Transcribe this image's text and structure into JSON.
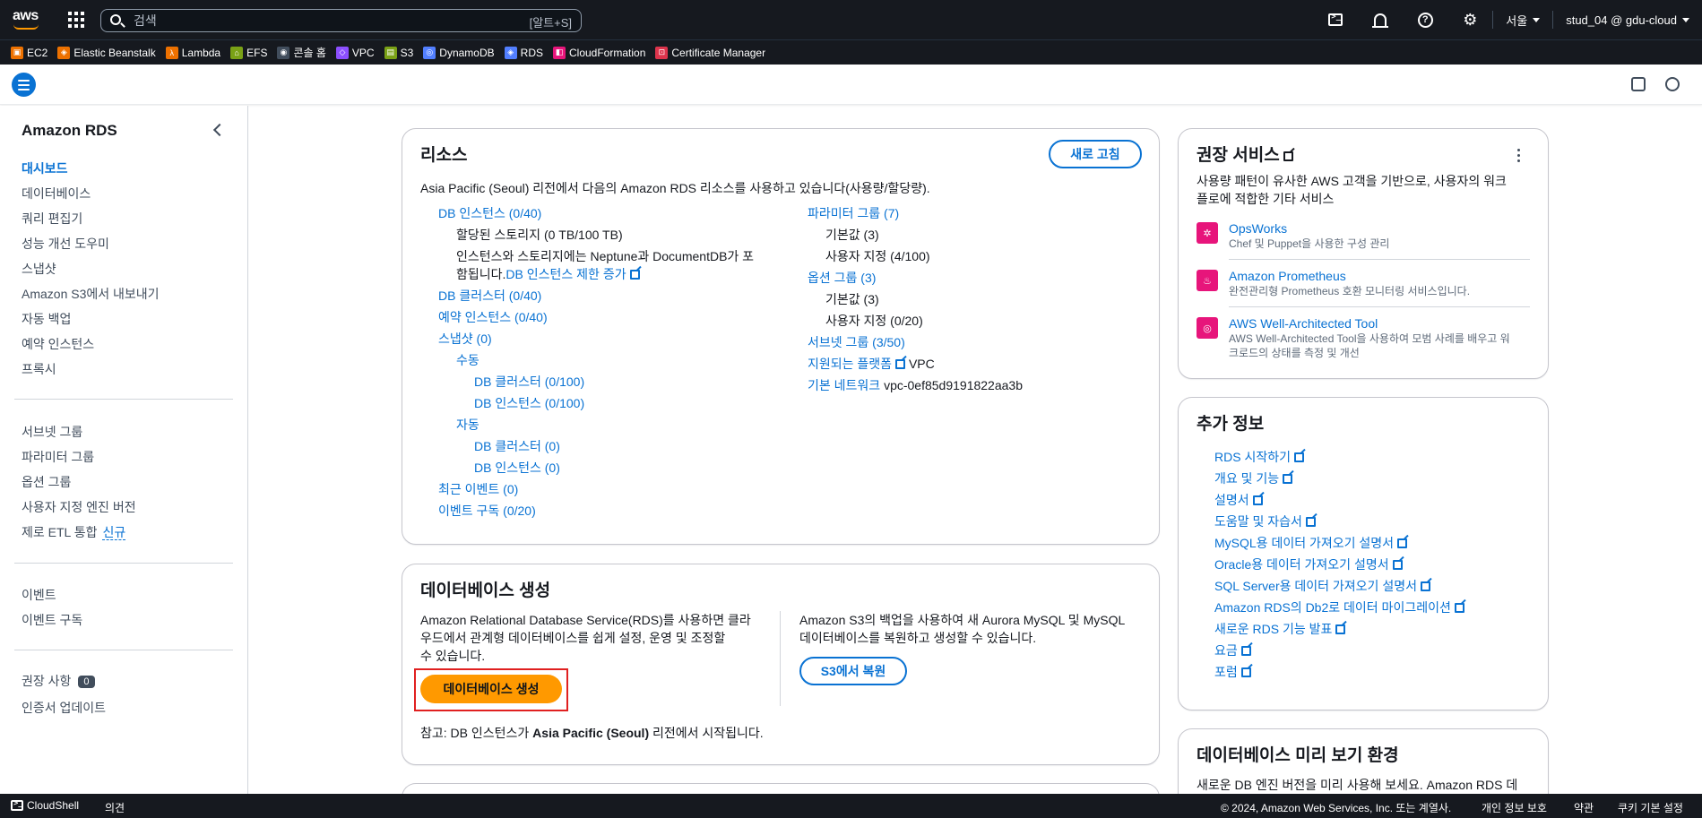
{
  "topnav": {
    "logo_text": "aws",
    "search_placeholder": "검색",
    "search_shortcut": "[알트+S]",
    "region": "서울",
    "account": "stud_04 @ gdu-cloud"
  },
  "favorites": [
    {
      "label": "EC2",
      "color": "#ed7100"
    },
    {
      "label": "Elastic Beanstalk",
      "color": "#ed7100"
    },
    {
      "label": "Lambda",
      "color": "#ed7100"
    },
    {
      "label": "EFS",
      "color": "#7aa116"
    },
    {
      "label": "콘솔 홈",
      "color": "#414d5c"
    },
    {
      "label": "VPC",
      "color": "#8c4fff"
    },
    {
      "label": "S3",
      "color": "#7aa116"
    },
    {
      "label": "DynamoDB",
      "color": "#527fff"
    },
    {
      "label": "RDS",
      "color": "#527fff"
    },
    {
      "label": "CloudFormation",
      "color": "#e7157b"
    },
    {
      "label": "Certificate Manager",
      "color": "#dd344c"
    }
  ],
  "sidebar": {
    "title": "Amazon RDS",
    "group1": [
      "대시보드",
      "데이터베이스",
      "쿼리 편집기",
      "성능 개선 도우미",
      "스냅샷",
      "Amazon S3에서 내보내기",
      "자동 백업",
      "예약 인스턴스",
      "프록시"
    ],
    "group2": [
      "서브넷 그룹",
      "파라미터 그룹",
      "옵션 그룹",
      "사용자 지정 엔진 버전",
      "제로 ETL 통합"
    ],
    "new_label": "신규",
    "group3": [
      "이벤트",
      "이벤트 구독"
    ],
    "recommendations": "권장 사항",
    "recommendations_count": "0",
    "cert_update": "인증서 업데이트"
  },
  "resources": {
    "title": "리소스",
    "refresh": "새로 고침",
    "intro": "Asia Pacific (Seoul) 리전에서 다음의 Amazon RDS 리소스를 사용하고 있습니다(사용량/할당량).",
    "db_instances": "DB 인스턴스 (0/40)",
    "storage": "할당된 스토리지 (0 TB/100 TB)",
    "note_line1": "인스턴스와 스토리지에는 Neptune과 DocumentDB가 포",
    "note_line2": "함됩니다.",
    "limit_link": "DB 인스턴스 제한 증가",
    "db_clusters": "DB 클러스터 (0/40)",
    "reserved": "예약 인스턴스 (0/40)",
    "snapshots": "스냅샷 (0)",
    "manual": "수동",
    "manual_clusters": "DB 클러스터 (0/100)",
    "manual_instances": "DB 인스턴스 (0/100)",
    "auto": "자동",
    "auto_clusters": "DB 클러스터 (0)",
    "auto_instances": "DB 인스턴스 (0)",
    "recent_events": "최근 이벤트 (0)",
    "event_subs": "이벤트 구독 (0/20)",
    "param_groups": "파라미터 그룹 (7)",
    "pg_default": "기본값 (3)",
    "pg_custom": "사용자 지정 (4/100)",
    "option_groups": "옵션 그룹 (3)",
    "og_default": "기본값 (3)",
    "og_custom": "사용자 지정 (0/20)",
    "subnet_groups": "서브넷 그룹 (3/50)",
    "supported_platforms": "지원되는 플랫폼",
    "platform_value": "VPC",
    "default_network": "기본 네트워크",
    "network_value": "vpc-0ef85d9191822aa3b"
  },
  "create_db": {
    "title": "데이터베이스 생성",
    "desc_line1": "Amazon Relational Database Service(RDS)를 사용하면 클라",
    "desc_line2": "우드에서 관계형 데이터베이스를 쉽게 설정, 운영 및 조정할",
    "desc_line3": "수 있습니다.",
    "create_button": "데이터베이스 생성",
    "s3_line1": "Amazon S3의 백업을 사용하여 새 Aurora MySQL 및 MySQL",
    "s3_line2": "데이터베이스를 복원하고 생성할 수 있습니다.",
    "s3_button": "S3에서 복원",
    "note_prefix": "참고: DB 인스턴스가 ",
    "note_region": "Asia Pacific (Seoul)",
    "note_suffix": " 리전에서 시작됩니다."
  },
  "recommended": {
    "title": "권장 서비스",
    "desc_line1": "사용량 패턴이 유사한 AWS 고객을 기반으로, 사용자의 워크",
    "desc_line2": "플로에 적합한 기타 서비스",
    "services": [
      {
        "name": "OpsWorks",
        "desc": "Chef 및 Puppet을 사용한 구성 관리",
        "color": "#e7157b"
      },
      {
        "name": "Amazon Prometheus",
        "desc": "완전관리형 Prometheus 호환 모니터링 서비스입니다.",
        "color": "#e7157b"
      },
      {
        "name": "AWS Well-Architected Tool",
        "desc1": "AWS Well-Architected Tool을 사용하여 모범 사례를 배우고 워",
        "desc2": "크로드의 상태를 측정 및 개선",
        "color": "#e7157b"
      }
    ]
  },
  "more_info": {
    "title": "추가 정보",
    "links": [
      "RDS 시작하기",
      "개요 및 기능",
      "설명서",
      "도움말 및 자습서",
      "MySQL용 데이터 가져오기 설명서",
      "Oracle용 데이터 가져오기 설명서",
      "SQL Server용 데이터 가져오기 설명서",
      "Amazon RDS의 Db2로 데이터 마이그레이션",
      "새로운 RDS 기능 발표",
      "요금",
      "포럼"
    ]
  },
  "preview": {
    "title": "데이터베이스 미리 보기 환경",
    "desc": "새로운 DB 엔진 버전을 미리 사용해 보세요. Amazon RDS 데"
  },
  "footer": {
    "cloudshell": "CloudShell",
    "feedback": "의견",
    "copyright": "© 2024, Amazon Web Services, Inc. 또는 계열사.",
    "privacy": "개인 정보 보호",
    "terms": "약관",
    "cookies": "쿠키 기본 설정"
  }
}
